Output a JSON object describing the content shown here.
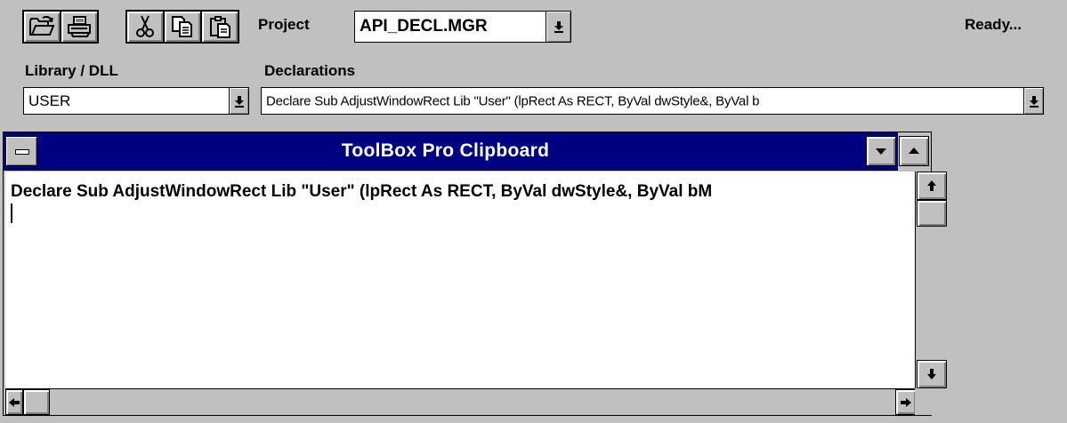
{
  "toolbar": {
    "icons": [
      "open-folder-icon",
      "print-icon",
      "cut-icon",
      "copy-icon",
      "paste-icon"
    ],
    "project_label": "Project",
    "project_value": "API_DECL.MGR",
    "status": "Ready..."
  },
  "library": {
    "label": "Library / DLL",
    "value": "USER"
  },
  "declarations": {
    "label": "Declarations",
    "value": "Declare Sub AdjustWindowRect Lib \"User\" (lpRect As RECT, ByVal dwStyle&, ByVal b"
  },
  "clipboard": {
    "title": "ToolBox Pro Clipboard",
    "content": "Declare Sub AdjustWindowRect Lib \"User\" (lpRect As RECT, ByVal dwStyle&, ByVal bM"
  },
  "colors": {
    "window_bg": "#c0c0c0",
    "title_bar": "#000080",
    "title_text": "#ffffff",
    "editor_bg": "#ffffff"
  }
}
